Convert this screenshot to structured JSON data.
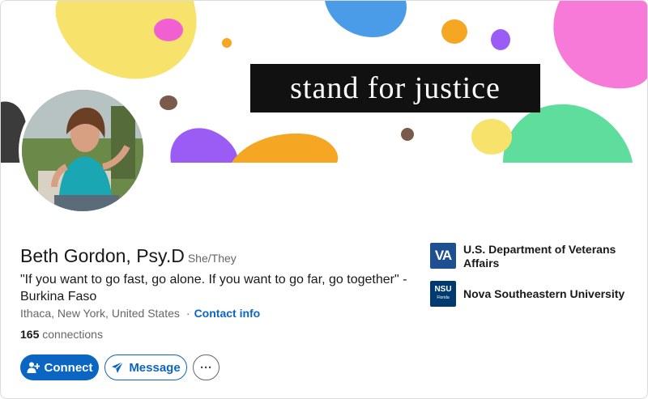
{
  "banner": {
    "slogan": "stand for justice"
  },
  "profile": {
    "name": "Beth Gordon, Psy.D",
    "pronouns": "She/They",
    "headline": "\"If you want to go fast, go alone. If you want to go far, go together\" - Burkina Faso",
    "location": "Ithaca, New York, United States",
    "separator": "·",
    "contact_label": "Contact info",
    "connections_count": "165",
    "connections_label": "connections"
  },
  "actions": {
    "connect_label": "Connect",
    "message_label": "Message",
    "more_label": "···"
  },
  "organizations": [
    {
      "logo_text": "VA",
      "name": "U.S. Department of Veterans Affairs"
    },
    {
      "logo_text": "NSU",
      "logo_subtext": "Florida",
      "name": "Nova Southeastern University"
    }
  ],
  "colors": {
    "accent": "#0a66c2",
    "text_primary": "#191919",
    "text_secondary": "#666666"
  }
}
